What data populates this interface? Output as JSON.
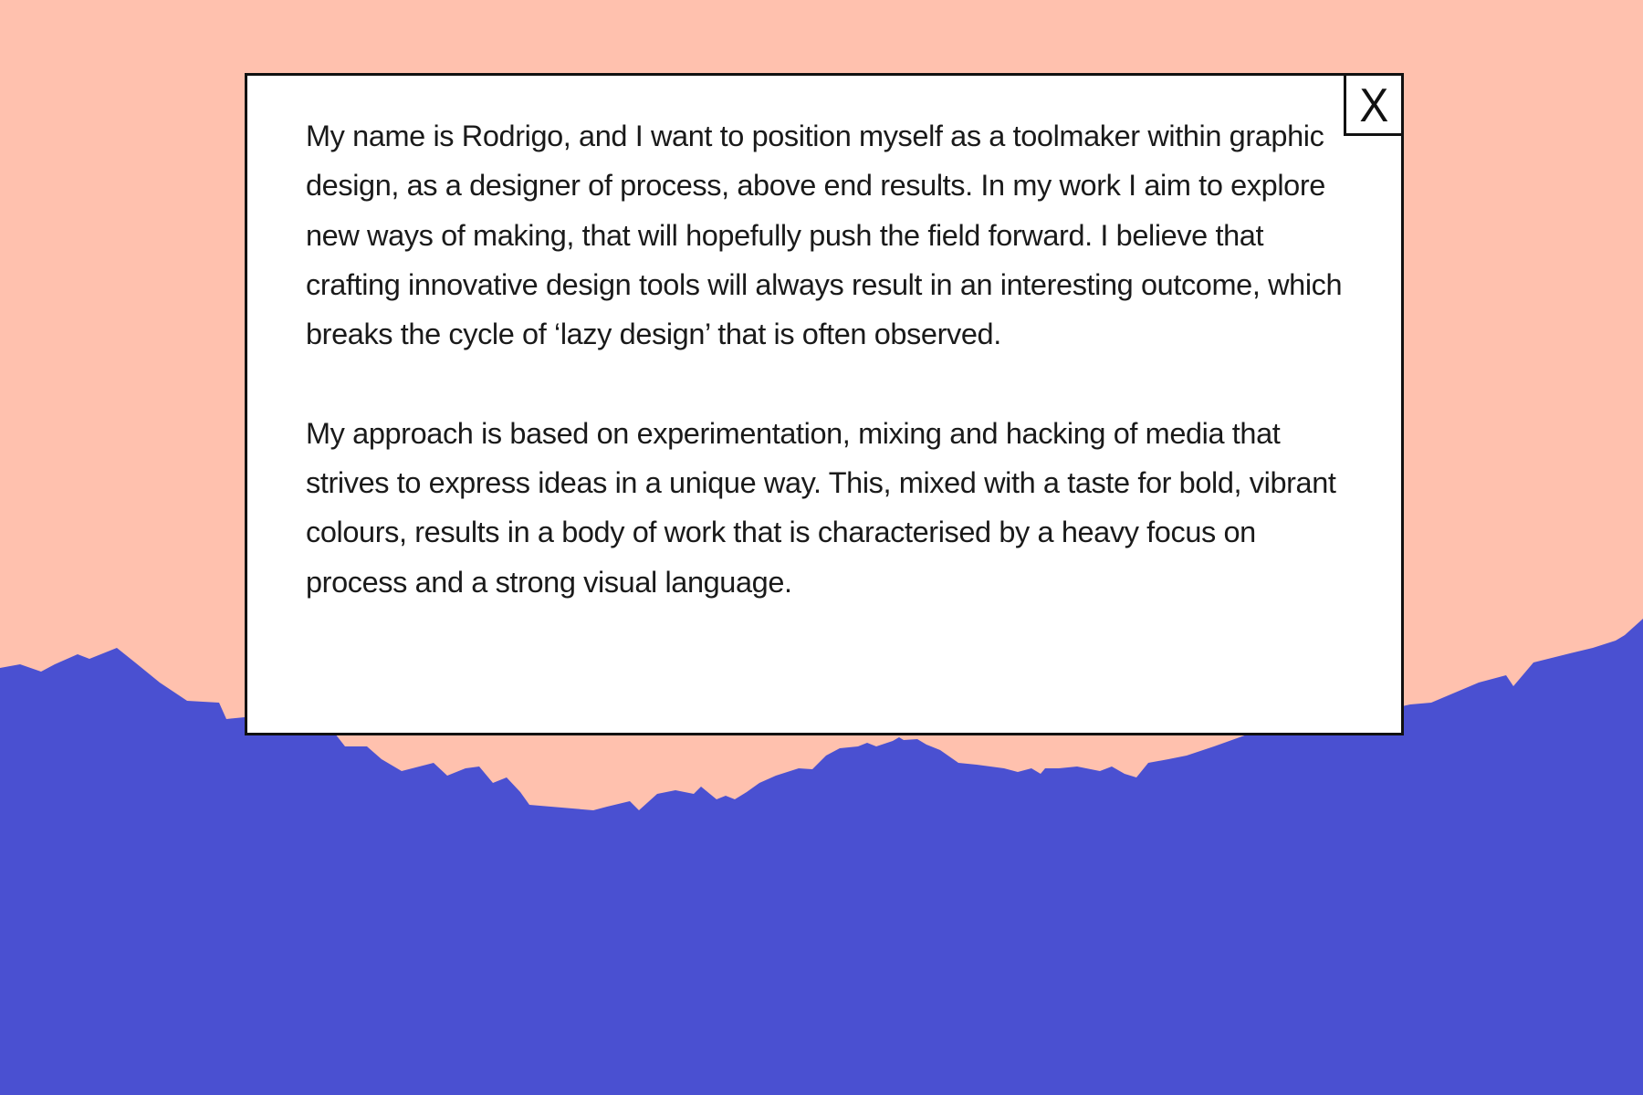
{
  "colors": {
    "sky": "#FFC1AE",
    "mountains": "#4A50D1",
    "modal_bg": "#FFFFFF",
    "border": "#111111",
    "text": "#1A1A1A"
  },
  "about_modal": {
    "close_label": "X",
    "paragraphs": [
      "My name is Rodrigo, and I want to position myself as a toolmaker within graphic design, as a designer of process, above end results. In my work I aim to explore new ways of making, that will hopefully push the field forward. I believe that crafting innovative design tools will always result in an interesting outcome, which breaks the cycle of ‘lazy design’ that is often observed.",
      "My approach is based on experimentation, mixing and hacking of media that strives to express ideas in a unique way. This, mixed with a taste for bold, vibrant colours, results in a body of work that is characterised by a heavy focus on process and a strong visual language."
    ]
  }
}
